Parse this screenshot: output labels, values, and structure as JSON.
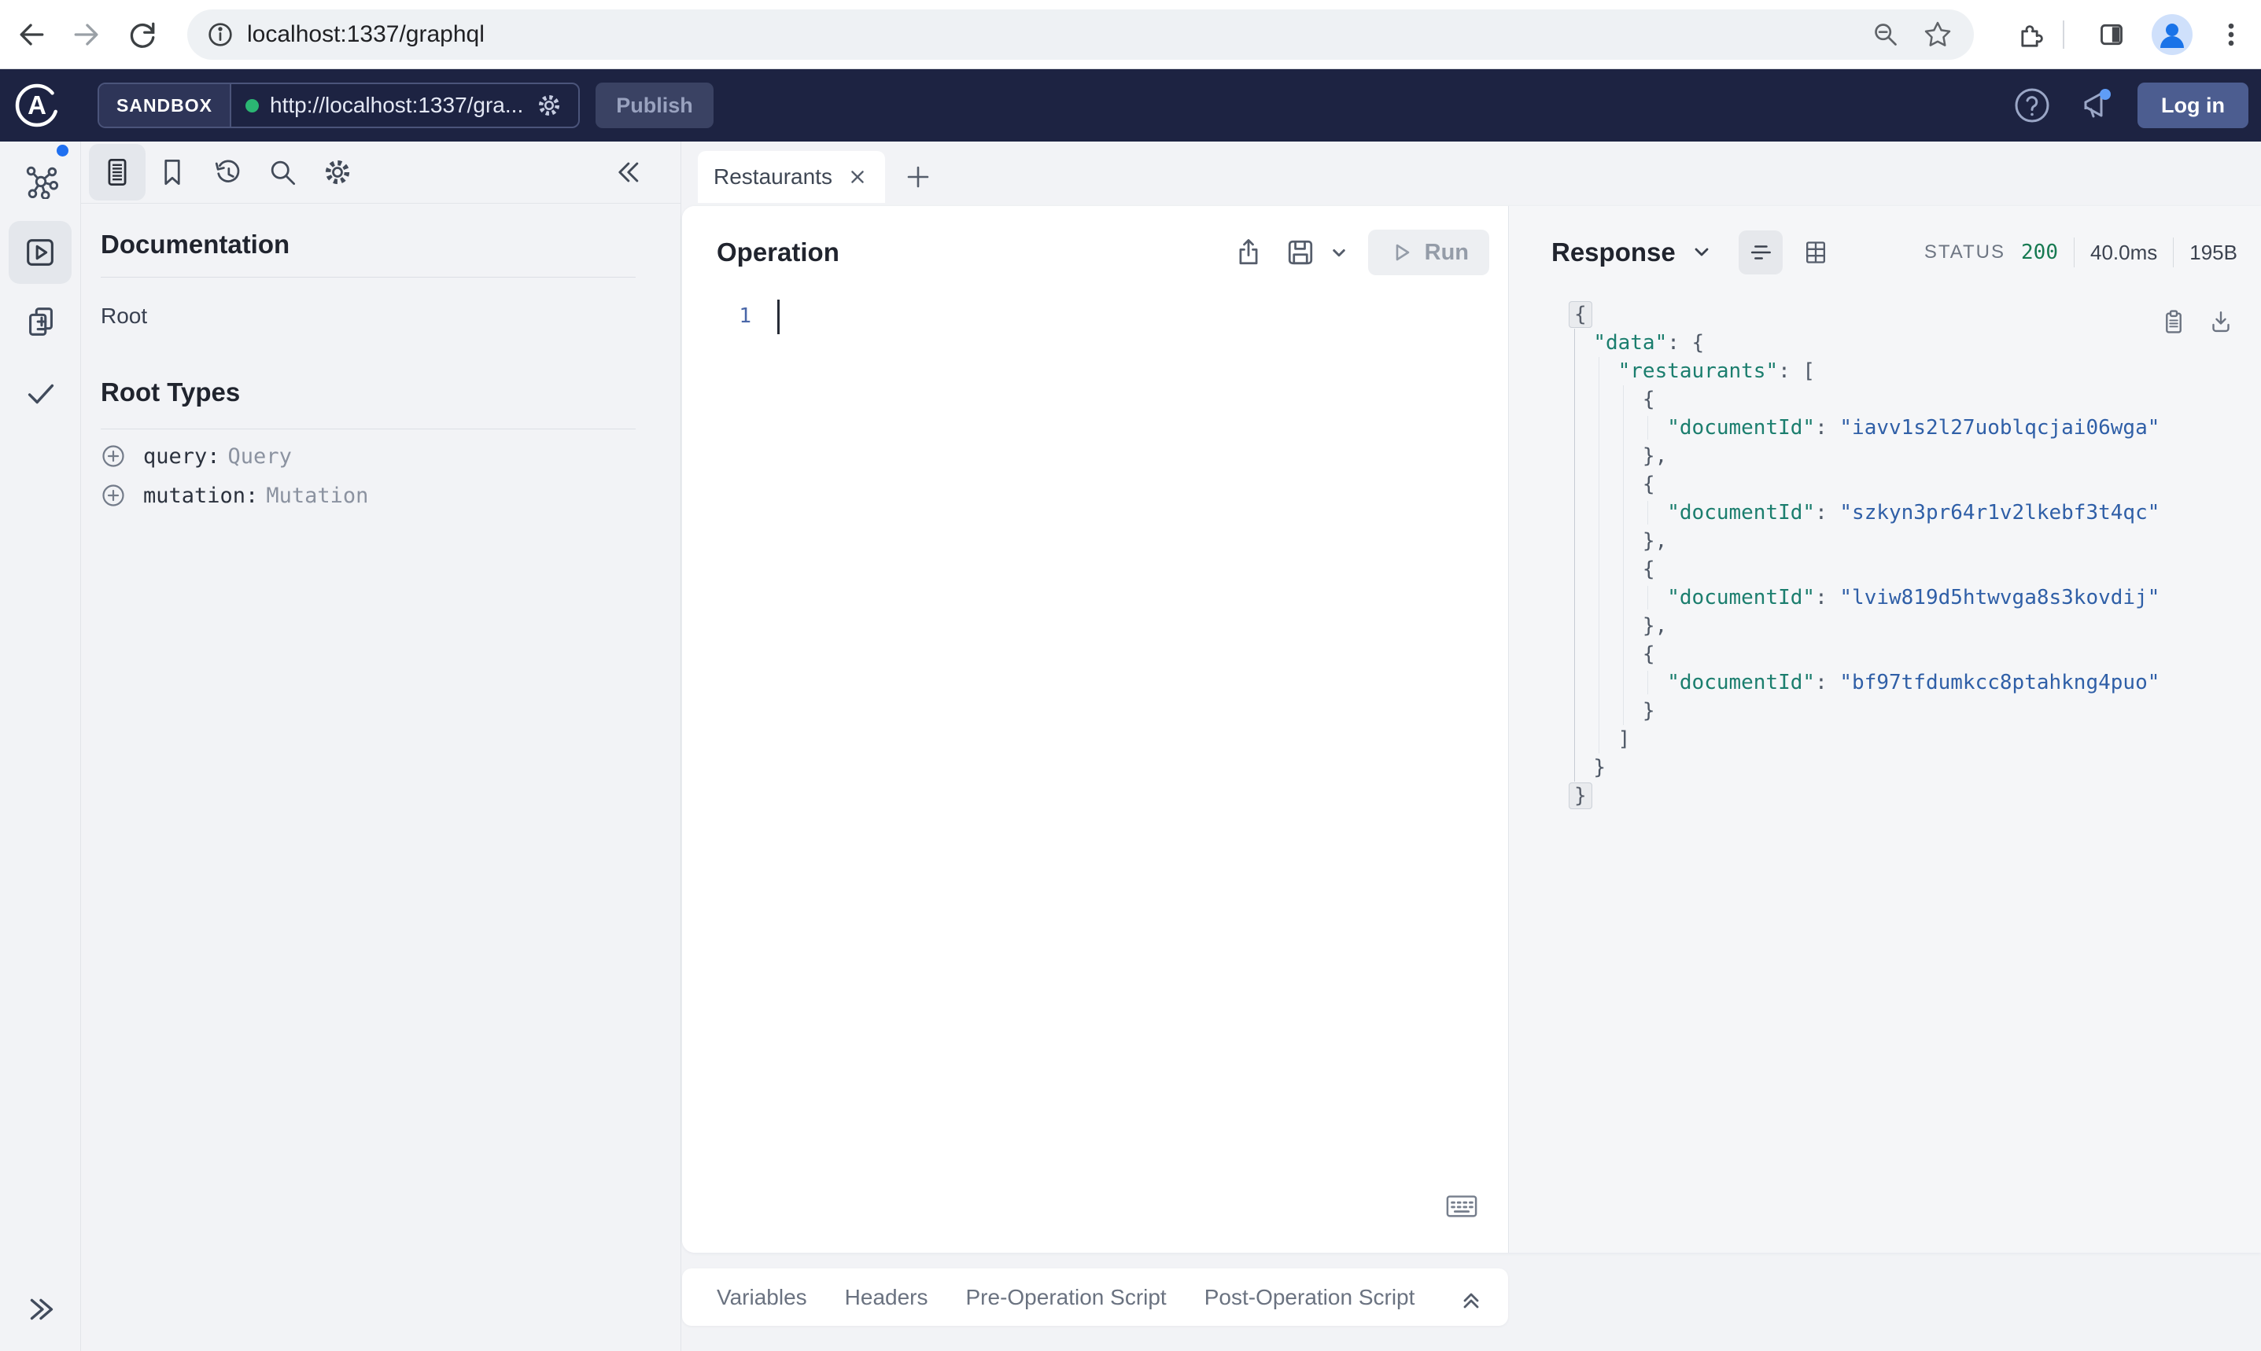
{
  "browser": {
    "url": "localhost:1337/graphql"
  },
  "apollo_header": {
    "sandbox_label": "SANDBOX",
    "endpoint_url": "http://localhost:1337/gra...",
    "publish_label": "Publish",
    "login_label": "Log in",
    "brand_letter": "A"
  },
  "docs_panel": {
    "title": "Documentation",
    "root_label": "Root",
    "root_types_title": "Root Types",
    "root_types": [
      {
        "key": "query:",
        "type": "Query"
      },
      {
        "key": "mutation:",
        "type": "Mutation"
      }
    ]
  },
  "tabs": {
    "active_tab": "Restaurants"
  },
  "operation": {
    "title": "Operation",
    "run_label": "Run",
    "line_number": "1"
  },
  "bottom_tabs": {
    "items": [
      "Variables",
      "Headers",
      "Pre-Operation Script",
      "Post-Operation Script"
    ]
  },
  "response": {
    "title": "Response",
    "status_label": "STATUS",
    "status_code": "200",
    "time": "40.0ms",
    "size": "195B",
    "restaurant_document_ids": [
      "iavv1s2l27uoblqcjai06wga",
      "szkyn3pr64r1v2lkebf3t4qc",
      "lviw819d5htwvga8s3kovdij",
      "bf97tfdumkcc8ptahkng4puo"
    ],
    "json_lines": [
      [
        {
          "t": "{",
          "c": "p fold"
        }
      ],
      [
        {
          "t": "  "
        },
        {
          "t": "\"data\"",
          "c": "k"
        },
        {
          "t": ": {",
          "c": "p"
        }
      ],
      [
        {
          "t": "    "
        },
        {
          "t": "\"restaurants\"",
          "c": "k"
        },
        {
          "t": ": [",
          "c": "p"
        }
      ],
      [
        {
          "t": "      "
        },
        {
          "t": "{",
          "c": "p"
        }
      ],
      [
        {
          "t": "        "
        },
        {
          "t": "\"documentId\"",
          "c": "k"
        },
        {
          "t": ": ",
          "c": "p"
        },
        {
          "t": "\"iavv1s2l27uoblqcjai06wga\"",
          "c": "s"
        }
      ],
      [
        {
          "t": "      "
        },
        {
          "t": "},",
          "c": "p"
        }
      ],
      [
        {
          "t": "      "
        },
        {
          "t": "{",
          "c": "p"
        }
      ],
      [
        {
          "t": "        "
        },
        {
          "t": "\"documentId\"",
          "c": "k"
        },
        {
          "t": ": ",
          "c": "p"
        },
        {
          "t": "\"szkyn3pr64r1v2lkebf3t4qc\"",
          "c": "s"
        }
      ],
      [
        {
          "t": "      "
        },
        {
          "t": "},",
          "c": "p"
        }
      ],
      [
        {
          "t": "      "
        },
        {
          "t": "{",
          "c": "p"
        }
      ],
      [
        {
          "t": "        "
        },
        {
          "t": "\"documentId\"",
          "c": "k"
        },
        {
          "t": ": ",
          "c": "p"
        },
        {
          "t": "\"lviw819d5htwvga8s3kovdij\"",
          "c": "s"
        }
      ],
      [
        {
          "t": "      "
        },
        {
          "t": "},",
          "c": "p"
        }
      ],
      [
        {
          "t": "      "
        },
        {
          "t": "{",
          "c": "p"
        }
      ],
      [
        {
          "t": "        "
        },
        {
          "t": "\"documentId\"",
          "c": "k"
        },
        {
          "t": ": ",
          "c": "p"
        },
        {
          "t": "\"bf97tfdumkcc8ptahkng4puo\"",
          "c": "s"
        }
      ],
      [
        {
          "t": "      "
        },
        {
          "t": "}",
          "c": "p"
        }
      ],
      [
        {
          "t": "    "
        },
        {
          "t": "]",
          "c": "p"
        }
      ],
      [
        {
          "t": "  "
        },
        {
          "t": "}",
          "c": "p"
        }
      ],
      [
        {
          "t": "}",
          "c": "p fold"
        }
      ]
    ]
  },
  "colors": {
    "header_navy": "#1d2342",
    "accent_blue": "#1f6ff0",
    "status_green": "#177a52",
    "json_key_teal": "#1b7e6e",
    "json_string_blue": "#2f5fa7"
  }
}
